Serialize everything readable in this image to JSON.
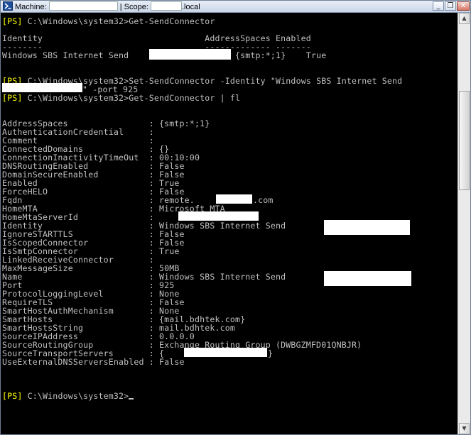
{
  "window": {
    "title_machine_label": "Machine:",
    "title_separator": "| Scope:",
    "title_suffix": ".local",
    "minimize_label": "_",
    "restore_label": "❐",
    "close_label": "✕"
  },
  "console": {
    "prompt": "[PS]",
    "path": " C:\\Windows\\system32>",
    "cmd1": "Get-SendConnector",
    "header_line": "Identity                                AddressSpaces Enabled",
    "header_dash": "--------                                ------------- -------",
    "result_identity": "Windows SBS Internet Send",
    "result_tail": "{smtp:*;1}    True",
    "cmd2": "Get-SendConnector -Identity \"Windows SBS Internet Send",
    "cmd2_cont": "\" -port 925",
    "cmd3": "Get-SendConnector | fl",
    "properties": [
      {
        "name": "AddressSpaces",
        "value": "{smtp:*;1}"
      },
      {
        "name": "AuthenticationCredential",
        "value": ""
      },
      {
        "name": "Comment",
        "value": ""
      },
      {
        "name": "ConnectedDomains",
        "value": "{}"
      },
      {
        "name": "ConnectionInactivityTimeOut",
        "value": "00:10:00"
      },
      {
        "name": "DNSRoutingEnabled",
        "value": "False"
      },
      {
        "name": "DomainSecureEnabled",
        "value": "False"
      },
      {
        "name": "Enabled",
        "value": "True"
      },
      {
        "name": "ForceHELO",
        "value": "False"
      },
      {
        "name": "Fqdn",
        "value": "remote.",
        "suffix": ".com"
      },
      {
        "name": "HomeMTA",
        "value": "Microsoft MTA"
      },
      {
        "name": "HomeMtaServerId",
        "value": ""
      },
      {
        "name": "Identity",
        "value": "Windows SBS Internet Send"
      },
      {
        "name": "IgnoreSTARTTLS",
        "value": "False"
      },
      {
        "name": "IsScopedConnector",
        "value": "False"
      },
      {
        "name": "IsSmtpConnector",
        "value": "True"
      },
      {
        "name": "LinkedReceiveConnector",
        "value": ""
      },
      {
        "name": "MaxMessageSize",
        "value": "50MB"
      },
      {
        "name": "Name",
        "value": "Windows SBS Internet Send"
      },
      {
        "name": "Port",
        "value": "925"
      },
      {
        "name": "ProtocolLoggingLevel",
        "value": "None"
      },
      {
        "name": "RequireTLS",
        "value": "False"
      },
      {
        "name": "SmartHostAuthMechanism",
        "value": "None"
      },
      {
        "name": "SmartHosts",
        "value": "{mail.bdhtek.com}"
      },
      {
        "name": "SmartHostsString",
        "value": "mail.bdhtek.com"
      },
      {
        "name": "SourceIPAddress",
        "value": "0.0.0.0"
      },
      {
        "name": "SourceRoutingGroup",
        "value": "Exchange Routing Group (DWBGZMFD01QNBJR)"
      },
      {
        "name": "SourceTransportServers",
        "value": "{",
        "suffix": "}"
      },
      {
        "name": "UseExternalDNSServersEnabled",
        "value": "False"
      }
    ],
    "final_prompt_path": " C:\\Windows\\system32>"
  },
  "scrollbar": {
    "up_icon": "arrow-up-icon",
    "down_icon": "arrow-down-icon",
    "up_glyph": "▲",
    "down_glyph": "▼"
  }
}
